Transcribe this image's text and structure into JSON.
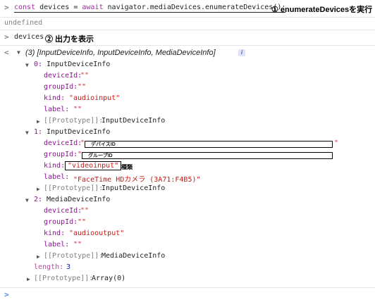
{
  "line1": {
    "prompt": ">",
    "kw_const": "const",
    "varname": "devices",
    "eq": "=",
    "kw_await": "await",
    "call": "navigator.mediaDevices.enumerateDevices();",
    "annotation": "① enumerateDevicesを実行"
  },
  "result1": {
    "text": "undefined"
  },
  "line2": {
    "prompt": ">",
    "code": "devices",
    "annotation": "② 出力を表示"
  },
  "summary": {
    "prompt": "<",
    "text": "(3) [InputDeviceInfo, InputDeviceInfo, MediaDeviceInfo]",
    "info_badge": "i"
  },
  "devices": [
    {
      "index": "0:",
      "type": "InputDeviceInfo",
      "deviceId_key": "deviceId:",
      "deviceId_val": "\"\"",
      "groupId_key": "groupId:",
      "groupId_val": "\"\"",
      "kind_key": "kind:",
      "kind_val": "\"audioinput\"",
      "label_key": "label:",
      "label_val": "\"\"",
      "proto_key": "[[Prototype]]:",
      "proto_val": "InputDeviceInfo"
    },
    {
      "index": "1:",
      "type": "InputDeviceInfo",
      "deviceId_key": "deviceId:",
      "deviceId_quote_open": "\"",
      "deviceId_redacted": "デバイスID",
      "deviceId_quote_close": "\"",
      "groupId_key": "groupId:",
      "groupId_quote_open": "\"",
      "groupId_redacted": "グループID",
      "kind_key": "kind:",
      "kind_val": "\"videoinput\"",
      "kind_annotation": "種類",
      "label_key": "label:",
      "label_val": "\"FaceTime HDカメラ (3A71:F4B5)\"",
      "proto_key": "[[Prototype]]:",
      "proto_val": "InputDeviceInfo"
    },
    {
      "index": "2:",
      "type": "MediaDeviceInfo",
      "deviceId_key": "deviceId:",
      "deviceId_val": "\"\"",
      "groupId_key": "groupId:",
      "groupId_val": "\"\"",
      "kind_key": "kind:",
      "kind_val": "\"audiooutput\"",
      "label_key": "label:",
      "label_val": "\"\"",
      "proto_key": "[[Prototype]]:",
      "proto_val": "MediaDeviceInfo"
    }
  ],
  "length": {
    "key": "length:",
    "val": "3"
  },
  "array_proto": {
    "key": "[[Prototype]]:",
    "val": "Array(0)"
  },
  "final_prompt": ">"
}
